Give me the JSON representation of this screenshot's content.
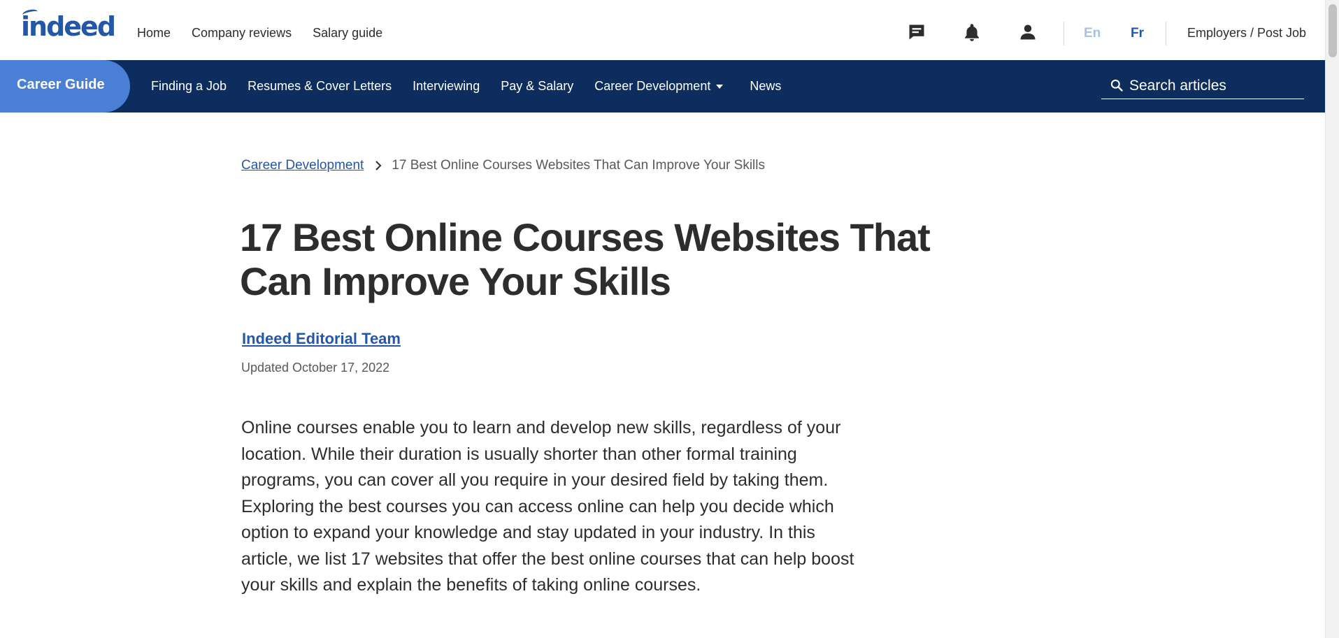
{
  "header": {
    "logo": "indeed",
    "nav": [
      "Home",
      "Company reviews",
      "Salary guide"
    ],
    "languages": {
      "en": "En",
      "fr": "Fr"
    },
    "employers": "Employers / Post Job"
  },
  "career_nav": {
    "badge": "Career Guide",
    "links": [
      "Finding a Job",
      "Resumes & Cover Letters",
      "Interviewing",
      "Pay & Salary",
      "Career Development",
      "News"
    ],
    "search_placeholder": "Search articles"
  },
  "article": {
    "breadcrumb_parent": "Career Development",
    "breadcrumb_current": "17 Best Online Courses Websites That Can Improve Your Skills",
    "title": "17 Best Online Courses Websites That Can Improve Your Skills",
    "author": "Indeed Editorial Team",
    "updated": "Updated October 17, 2022",
    "intro": "Online courses enable you to learn and develop new skills, regardless of your location. While their duration is usually shorter than other formal training programs, you can cover all you require in your desired field by taking them. Exploring the best courses you can access online can help you decide which option to expand your knowledge and stay updated in your industry. In this article, we list 17 websites that offer the best online courses that can help boost your skills and explain the benefits of taking online courses."
  },
  "icons": [
    "message-icon",
    "bell-icon",
    "profile-icon",
    "search-icon",
    "chevron-right-icon",
    "caret-down-icon"
  ],
  "colors": {
    "brand": "#2557a7",
    "nav_bg": "#0d2d5e",
    "badge": "#4a7fd6",
    "text": "#2d2d2d"
  }
}
